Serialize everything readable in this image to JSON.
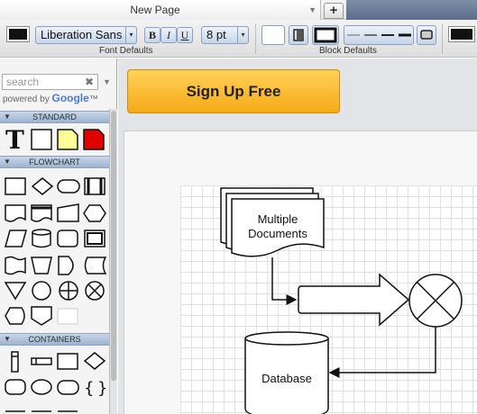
{
  "tab": {
    "title": "New Page",
    "new_tab_symbol": "+"
  },
  "toolbar": {
    "font_name": "Liberation Sans",
    "bold": "B",
    "italic": "I",
    "underline": "U",
    "font_size": "8 pt",
    "font_group_label": "Font Defaults",
    "block_group_label": "Block Defaults"
  },
  "sidebar": {
    "search_placeholder": "search",
    "powered_by": "powered by",
    "google": "Google",
    "tm": "™",
    "sections": [
      "STANDARD",
      "FLOWCHART",
      "CONTAINERS"
    ]
  },
  "promo": {
    "signup_label": "Sign Up Free"
  },
  "diagram": {
    "multiple_documents": [
      "Multiple",
      "Documents"
    ],
    "database": "Database"
  },
  "colors": {
    "accent": "#f7a915",
    "note": "#ffff99",
    "red_note": "#e00000",
    "header": "#9eb3cf"
  }
}
